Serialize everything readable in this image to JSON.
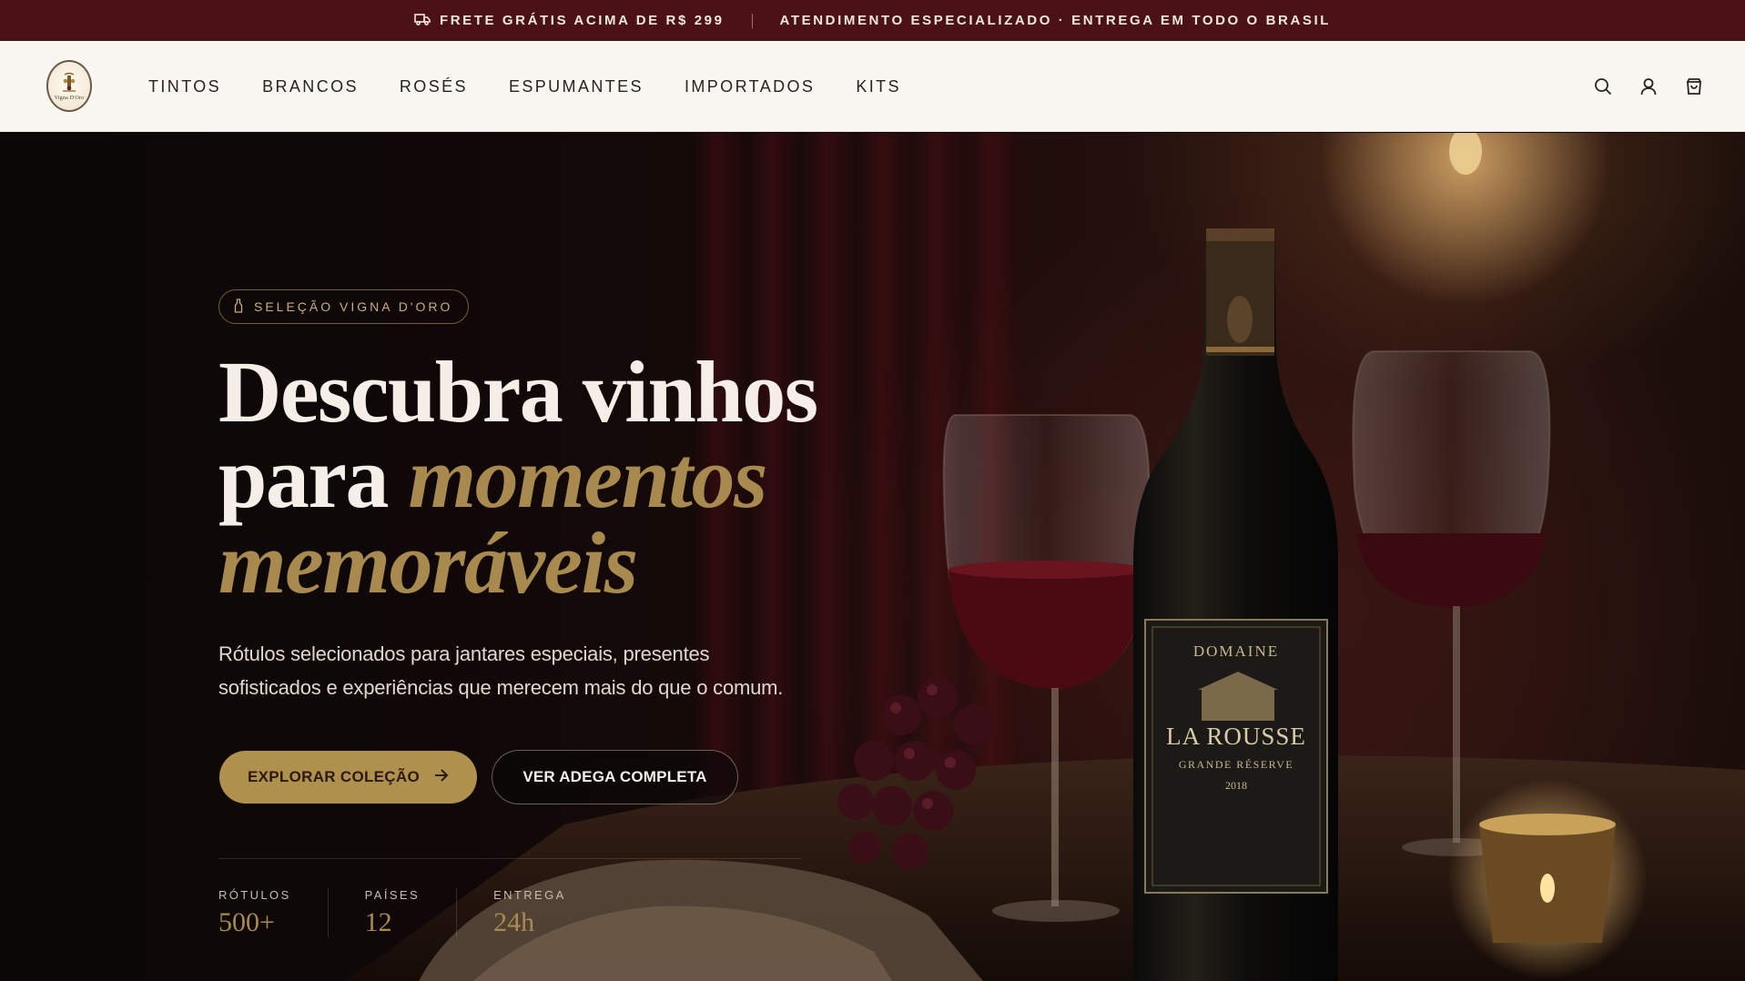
{
  "topbar": {
    "shipping_text": "FRETE GRÁTIS ACIMA DE R$ 299",
    "support_text": "ATENDIMENTO ESPECIALIZADO · ENTREGA EM TODO O BRASIL",
    "icon": "truck-icon"
  },
  "header": {
    "logo_text": "Vigna D'Oro",
    "nav": [
      "TINTOS",
      "BRANCOS",
      "ROSÉS",
      "ESPUMANTES",
      "IMPORTADOS",
      "KITS"
    ],
    "icons": [
      "search-icon",
      "user-icon",
      "shopping-bag-icon"
    ]
  },
  "hero": {
    "badge": "SELEÇÃO VIGNA D'ORO",
    "headline_line1": "Descubra vinhos",
    "headline_line2_plain": "para ",
    "headline_line2_gold": "momentos",
    "headline_line3_gold": "memoráveis",
    "subtext_line1": "Rótulos selecionados para jantares especiais, presentes",
    "subtext_line2": "sofisticados e experiências que merecem mais do que o comum.",
    "primary_button": "EXPLORAR COLEÇÃO",
    "secondary_button": "VER ADEGA COMPLETA",
    "stats": [
      {
        "label": "RÓTULOS",
        "value": "500+"
      },
      {
        "label": "PAÍSES",
        "value": "12"
      },
      {
        "label": "ENTREGA",
        "value": "24h"
      }
    ],
    "bottle_label": {
      "top": "DOMAINE",
      "name": "LA ROUSSE",
      "sub": "GRANDE RÉSERVE",
      "year": "2018"
    }
  },
  "colors": {
    "topbar_bg": "#4a1117",
    "accent_gold": "#b0904d",
    "headline_gold": "#a88a4e",
    "header_bg": "#faf7f3"
  }
}
